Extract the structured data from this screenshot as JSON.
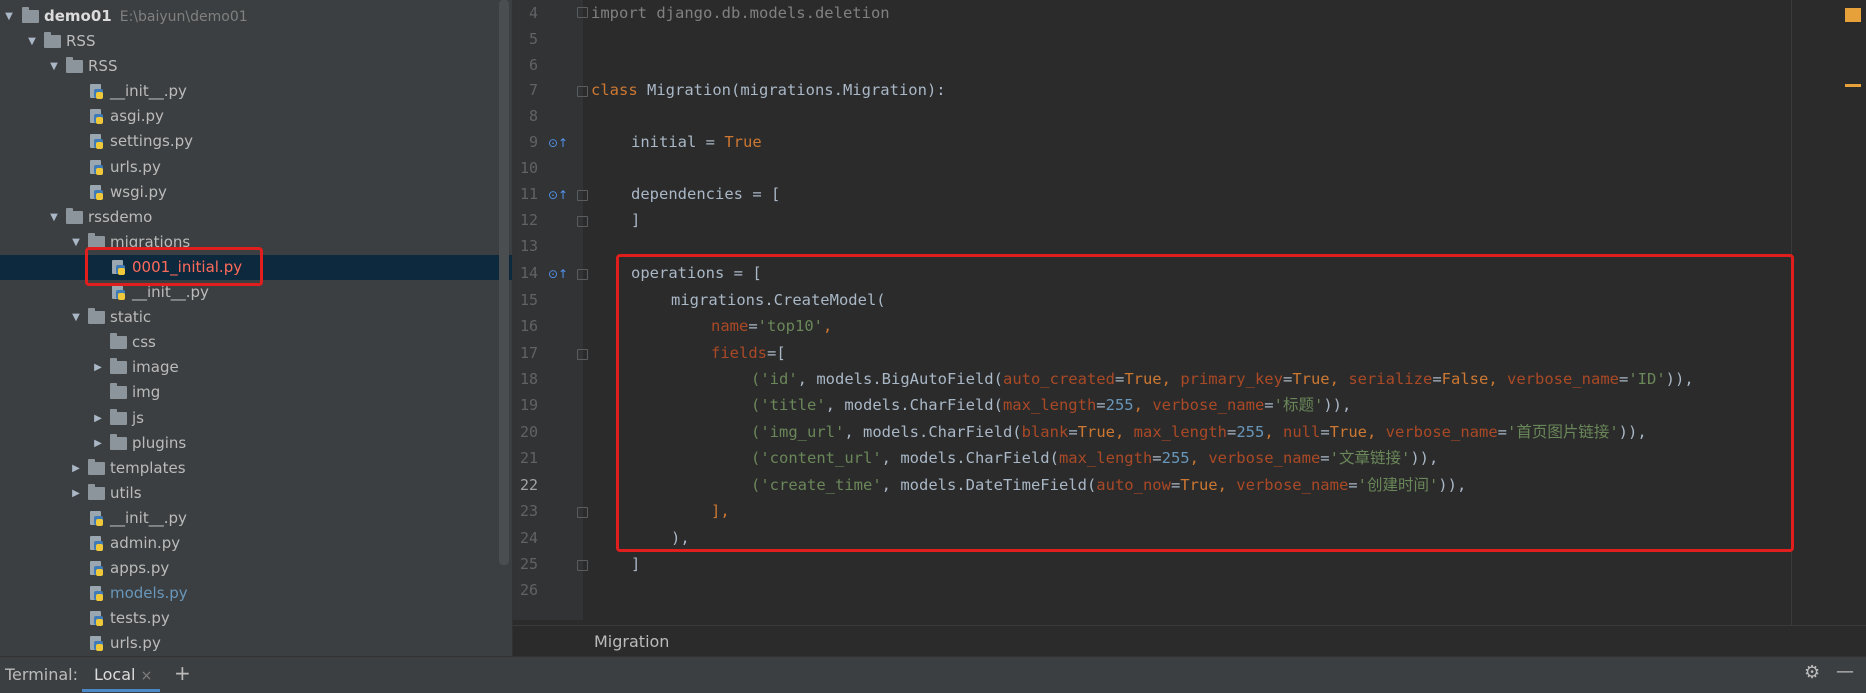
{
  "project_tree": {
    "root": {
      "label": "demo01",
      "path": "E:\\baiyun\\demo01"
    },
    "items": [
      {
        "label": "RSS",
        "type": "folder",
        "depth": 1,
        "expanded": true
      },
      {
        "label": "RSS",
        "type": "folder",
        "depth": 2,
        "expanded": true
      },
      {
        "label": "__init__.py",
        "type": "py",
        "depth": 3
      },
      {
        "label": "asgi.py",
        "type": "py",
        "depth": 3
      },
      {
        "label": "settings.py",
        "type": "py",
        "depth": 3
      },
      {
        "label": "urls.py",
        "type": "py",
        "depth": 3
      },
      {
        "label": "wsgi.py",
        "type": "py",
        "depth": 3
      },
      {
        "label": "rssdemo",
        "type": "folder",
        "depth": 2,
        "expanded": true
      },
      {
        "label": "migrations",
        "type": "folder",
        "depth": 3,
        "expanded": true
      },
      {
        "label": "0001_initial.py",
        "type": "py",
        "depth": 4,
        "selected": true
      },
      {
        "label": "__init__.py",
        "type": "py",
        "depth": 4
      },
      {
        "label": "static",
        "type": "folder",
        "depth": 3,
        "expanded": true
      },
      {
        "label": "css",
        "type": "folder",
        "depth": 4
      },
      {
        "label": "image",
        "type": "folder",
        "depth": 4,
        "collapsed": true
      },
      {
        "label": "img",
        "type": "folder",
        "depth": 4
      },
      {
        "label": "js",
        "type": "folder",
        "depth": 4,
        "collapsed": true
      },
      {
        "label": "plugins",
        "type": "folder",
        "depth": 4,
        "collapsed": true
      },
      {
        "label": "templates",
        "type": "folder",
        "depth": 3,
        "collapsed": true
      },
      {
        "label": "utils",
        "type": "folder",
        "depth": 3,
        "collapsed": true
      },
      {
        "label": "__init__.py",
        "type": "py",
        "depth": 3
      },
      {
        "label": "admin.py",
        "type": "py",
        "depth": 3
      },
      {
        "label": "apps.py",
        "type": "py",
        "depth": 3
      },
      {
        "label": "models.py",
        "type": "py",
        "depth": 3,
        "modified": true
      },
      {
        "label": "tests.py",
        "type": "py",
        "depth": 3
      },
      {
        "label": "urls.py",
        "type": "py",
        "depth": 3
      }
    ]
  },
  "editor": {
    "line_numbers": [
      "4",
      "5",
      "6",
      "7",
      "8",
      "9",
      "10",
      "11",
      "12",
      "13",
      "14",
      "15",
      "16",
      "17",
      "18",
      "19",
      "20",
      "21",
      "22",
      "23",
      "24",
      "25",
      "26"
    ],
    "code": {
      "l4_import": "import",
      "l4_mod": " django.db.models.deletion",
      "l7_class": "class",
      "l7_rest": " Migration(migrations.Migration):",
      "l9_a": "initial = ",
      "l9_b": "True",
      "l11": "dependencies = [",
      "l12": "]",
      "l14": "operations = [",
      "l15": "migrations.CreateModel(",
      "l16_k": "name",
      "l16_eq": "=",
      "l16_v": "'top10'",
      "l16_c": ",",
      "l17_k": "fields",
      "l17_r": "=[",
      "l18_a": "('id'",
      "l18_b": ", models.BigAutoField(",
      "l18_k1": "auto_created",
      "l18_v1": "True",
      "l18_k2": "primary_key",
      "l18_v2": "True",
      "l18_k3": "serialize",
      "l18_v3": "False",
      "l18_k4": "verbose_name",
      "l18_v4": "'ID'",
      "l18_end": ")),",
      "l19_a": "('title'",
      "l19_b": ", models.CharField(",
      "l19_k1": "max_length",
      "l19_v1": "255",
      "l19_k2": "verbose_name",
      "l19_v2": "'标题'",
      "l19_end": ")),",
      "l20_a": "('img_url'",
      "l20_b": ", models.CharField(",
      "l20_k1": "blank",
      "l20_v1": "True",
      "l20_k2": "max_length",
      "l20_v2": "255",
      "l20_k3": "null",
      "l20_v3": "True",
      "l20_k4": "verbose_name",
      "l20_v4": "'首页图片链接'",
      "l20_end": ")),",
      "l21_a": "('content_url'",
      "l21_b": ", models.CharField(",
      "l21_k1": "max_length",
      "l21_v1": "255",
      "l21_k2": "verbose_name",
      "l21_v2": "'文章链接'",
      "l21_end": ")),",
      "l22_a": "('create_time'",
      "l22_b": ", models.DateTimeField(",
      "l22_k1": "auto_now",
      "l22_v1": "True",
      "l22_k2": "verbose_name",
      "l22_v2": "'创建时间'",
      "l22_end": ")),",
      "l23": "],",
      "l24": "),",
      "l25": "]"
    },
    "breadcrumb": "Migration"
  },
  "terminal_bar": {
    "label": "Terminal:",
    "tab": "Local",
    "add": "+",
    "close": "×"
  },
  "colors": {
    "keyword": "#cc7832",
    "string": "#6a8759",
    "number": "#6897bb",
    "kwarg": "#aa4926",
    "highlight_box": "#e01e1e",
    "selection": "#0d293e"
  }
}
